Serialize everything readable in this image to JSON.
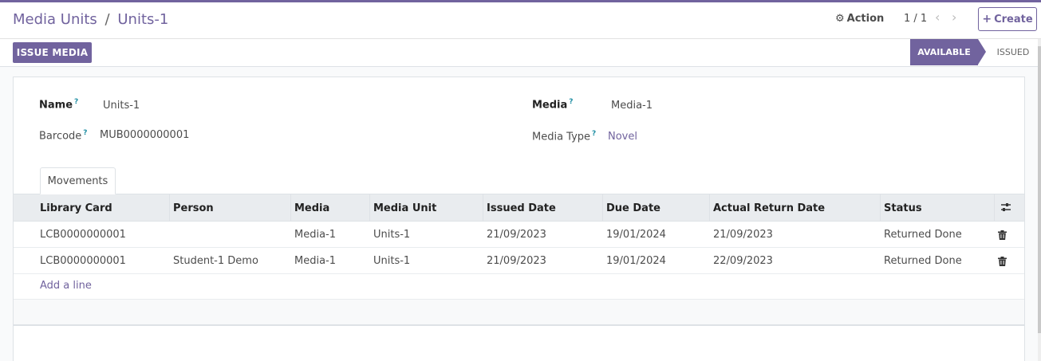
{
  "breadcrumb": {
    "parent": "Media Units",
    "separator": "/",
    "current": "Units-1"
  },
  "toolbar": {
    "action_label": "Action",
    "pager": "1 / 1",
    "create_label": "Create"
  },
  "statusbar": {
    "issue_button": "ISSUE MEDIA",
    "states": [
      "AVAILABLE",
      "ISSUED"
    ],
    "active_state": "AVAILABLE"
  },
  "form": {
    "name_label": "Name",
    "name_value": "Units-1",
    "barcode_label": "Barcode",
    "barcode_value": "MUB0000000001",
    "media_label": "Media",
    "media_value": "Media-1",
    "media_type_label": "Media Type",
    "media_type_value": "Novel",
    "help_marker": "?"
  },
  "tabs": [
    "Movements"
  ],
  "table": {
    "headers": [
      "Library Card",
      "Person",
      "Media",
      "Media Unit",
      "Issued Date",
      "Due Date",
      "Actual Return Date",
      "Status"
    ],
    "rows": [
      [
        "LCB0000000001",
        "",
        "Media-1",
        "Units-1",
        "21/09/2023",
        "19/01/2024",
        "21/09/2023",
        "Returned Done"
      ],
      [
        "LCB0000000001",
        "Student-1 Demo",
        "Media-1",
        "Units-1",
        "21/09/2023",
        "19/01/2024",
        "22/09/2023",
        "Returned Done"
      ]
    ],
    "add_line": "Add a line"
  },
  "colors": {
    "brand": "#71639e",
    "help": "#1f8ea3"
  }
}
